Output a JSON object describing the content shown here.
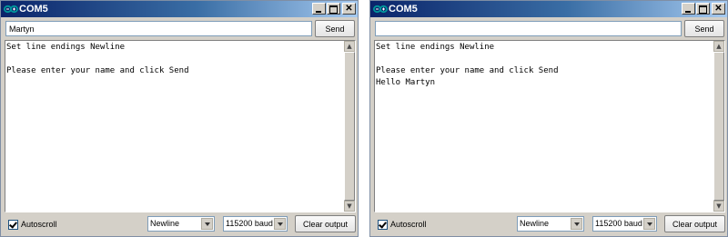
{
  "windows": [
    {
      "title": "COM5",
      "input_value": "Martyn",
      "send_label": "Send",
      "output_text": "Set line endings Newline\n\nPlease enter your name and click Send",
      "autoscroll_label": "Autoscroll",
      "autoscroll_checked": true,
      "line_ending": "Newline",
      "baud": "115200 baud",
      "clear_label": "Clear output",
      "window_buttons": {
        "minimize": "minimize-icon",
        "maximize": "maximize-icon",
        "close": "close-icon",
        "close_glyph": "✕"
      }
    },
    {
      "title": "COM5",
      "input_value": "",
      "send_label": "Send",
      "output_text": "Set line endings Newline\n\nPlease enter your name and click Send\nHello Martyn",
      "autoscroll_label": "Autoscroll",
      "autoscroll_checked": true,
      "line_ending": "Newline",
      "baud": "115200 baud",
      "clear_label": "Clear output",
      "window_buttons": {
        "minimize": "minimize-icon",
        "maximize": "maximize-icon",
        "close": "close-icon",
        "close_glyph": "✕"
      }
    }
  ],
  "colors": {
    "titlebar_start": "#0a246a",
    "titlebar_end": "#a6caf0",
    "arduino_logo": "#00979c",
    "window_bg": "#d4d0c8"
  },
  "icons": {
    "app": "arduino-infinity-icon",
    "scroll_up": "scroll-up-arrow-icon",
    "scroll_down": "scroll-down-arrow-icon",
    "dropdown": "chevron-down-icon",
    "checkbox": "checkmark-icon"
  }
}
